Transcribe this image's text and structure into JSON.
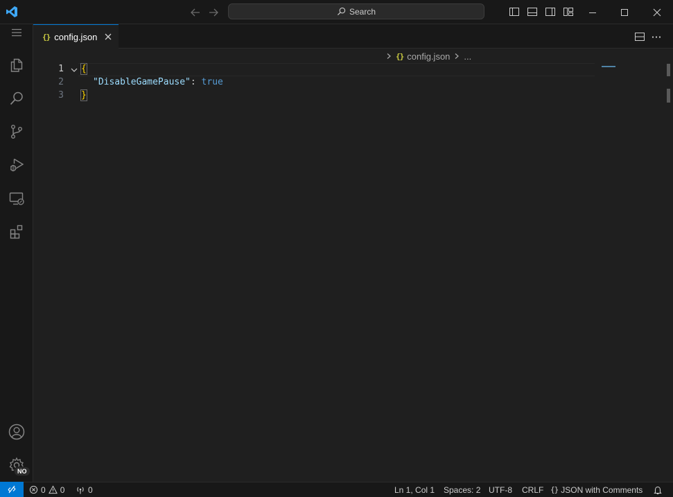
{
  "titlebar": {
    "search_label": "Search"
  },
  "tab": {
    "icon_text": "{}",
    "label": "config.json"
  },
  "breadcrumb": {
    "icon_text": "{}",
    "file": "config.json",
    "ellipsis": "..."
  },
  "editor": {
    "lines": [
      {
        "number": "1",
        "text": "{"
      },
      {
        "number": "2",
        "key": "\"DisableGamePause\"",
        "colon": ": ",
        "value": "true"
      },
      {
        "number": "3",
        "text": "}"
      }
    ]
  },
  "activity": {
    "accounts_badge": "NO"
  },
  "status": {
    "errors": "0",
    "warnings": "0",
    "ports": "0",
    "position": "Ln 1, Col 1",
    "spaces": "Spaces: 2",
    "encoding": "UTF-8",
    "eol": "CRLF",
    "language": "JSON with Comments"
  },
  "colors": {
    "accent": "#0078d4",
    "json_key": "#9cdcfe",
    "json_bool": "#569cd6",
    "bracket": "#ffd700"
  }
}
